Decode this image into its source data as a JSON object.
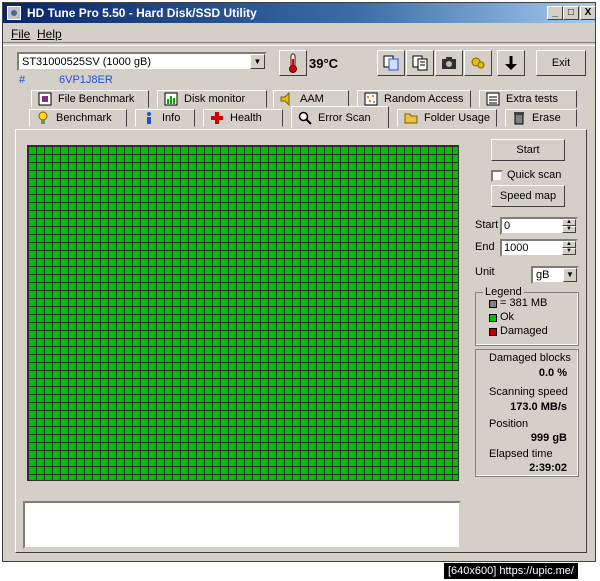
{
  "window": {
    "title": "HD Tune Pro 5.50 - Hard Disk/SSD Utility",
    "minimize": "_",
    "maximize": "□",
    "close": "X"
  },
  "menu": {
    "file": "File",
    "help": "Help"
  },
  "drive": {
    "selected": "ST31000525SV (1000 gB)",
    "serial_prefix": "#",
    "serial": "6VP1J8ER",
    "temperature": "39°C"
  },
  "toolbar": {
    "exit_label": "Exit",
    "icons": [
      "copy-info-icon",
      "copy-all-icon",
      "screenshot-icon",
      "options-icon",
      "save-icon"
    ]
  },
  "tabs_top": [
    {
      "label": "File Benchmark",
      "icon": "file-benchmark-icon"
    },
    {
      "label": "Disk monitor",
      "icon": "disk-monitor-icon"
    },
    {
      "label": "AAM",
      "icon": "speaker-icon"
    },
    {
      "label": "Random Access",
      "icon": "random-access-icon"
    },
    {
      "label": "Extra tests",
      "icon": "extra-tests-icon"
    }
  ],
  "tabs_bottom": [
    {
      "label": "Benchmark",
      "icon": "bulb-icon"
    },
    {
      "label": "Info",
      "icon": "info-icon"
    },
    {
      "label": "Health",
      "icon": "health-cross-icon"
    },
    {
      "label": "Error Scan",
      "icon": "magnifier-icon"
    },
    {
      "label": "Folder Usage",
      "icon": "folder-icon"
    },
    {
      "label": "Erase",
      "icon": "trash-icon"
    }
  ],
  "scan": {
    "start_label": "Start",
    "quick_scan_label": "Quick scan",
    "speed_map_label": "Speed map",
    "start_field_label": "Start",
    "start_value": "0",
    "end_field_label": "End",
    "end_value": "1000",
    "unit_label": "Unit",
    "unit_value": "gB"
  },
  "legend": {
    "title": "Legend",
    "block_size": "= 381 MB",
    "ok": "Ok",
    "damaged": "Damaged",
    "colors": {
      "block": "#808080",
      "ok": "#00c000",
      "damaged": "#c00000"
    }
  },
  "stats": {
    "damaged_blocks_label": "Damaged blocks",
    "damaged_blocks_value": "0.0 %",
    "scanning_speed_label": "Scanning speed",
    "scanning_speed_value": "173.0 MB/s",
    "position_label": "Position",
    "position_value": "999 gB",
    "elapsed_label": "Elapsed time",
    "elapsed_value": "2:39:02"
  },
  "footer_caption": "[640x600] https://upic.me/"
}
